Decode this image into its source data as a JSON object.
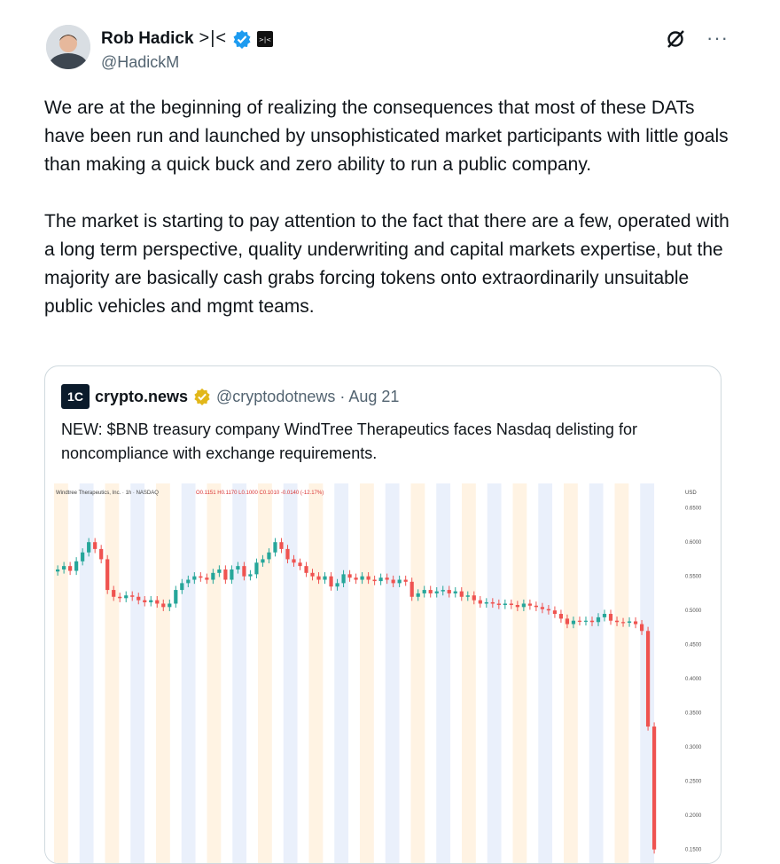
{
  "author": {
    "name": "Rob Hadick",
    "name_suffix": ">|<",
    "handle": "@HadickM",
    "verified_icon": "verified-badge-icon",
    "affiliation_icon": "affiliate-badge-icon"
  },
  "actions": {
    "grok_icon": "grok-icon",
    "more_icon": "more-icon",
    "more_glyph": "···"
  },
  "tweet": {
    "paragraph1": "We are at the beginning of realizing the consequences that most of these DATs have been run and launched by unsophisticated market participants with little goals than making a quick buck and zero ability to run a public company.",
    "paragraph2": "The market is starting to pay attention to the fact that there are a few, operated with a long term perspective, quality underwriting and capital markets expertise, but the majority are basically cash grabs forcing tokens onto extraordinarily unsuitable public vehicles and mgmt teams."
  },
  "quote": {
    "logo_text": "1C",
    "name": "crypto.news",
    "handle_date": "@cryptodotnews · Aug 21",
    "text": "NEW: $BNB treasury company WindTree Therapeutics faces Nasdaq delisting for noncompliance with exchange requirements."
  },
  "chart_data": {
    "type": "candlestick",
    "title": "Windtree Therapeutics, Inc. · 1h · NASDAQ",
    "ohlc_text": "O0.1151 H0.1170 L0.1000 C0.1010 -0.0140 (-12.17%)",
    "currency_label": "USD",
    "y_ticks": [
      "0.6500",
      "0.6000",
      "0.5500",
      "0.5000",
      "0.4500",
      "0.4000",
      "0.3500",
      "0.3000",
      "0.2500",
      "0.2000",
      "0.1500"
    ],
    "ylim": [
      0.13,
      0.66
    ],
    "up_color": "#26a69a",
    "down_color": "#ef5350",
    "closes": [
      0.56,
      0.565,
      0.558,
      0.572,
      0.585,
      0.6,
      0.59,
      0.575,
      0.53,
      0.52,
      0.518,
      0.522,
      0.52,
      0.515,
      0.512,
      0.515,
      0.51,
      0.505,
      0.51,
      0.53,
      0.54,
      0.545,
      0.55,
      0.548,
      0.545,
      0.555,
      0.56,
      0.545,
      0.56,
      0.565,
      0.55,
      0.553,
      0.57,
      0.575,
      0.585,
      0.6,
      0.59,
      0.575,
      0.57,
      0.565,
      0.555,
      0.55,
      0.545,
      0.55,
      0.535,
      0.54,
      0.553,
      0.548,
      0.545,
      0.55,
      0.545,
      0.543,
      0.548,
      0.545,
      0.54,
      0.545,
      0.542,
      0.52,
      0.525,
      0.53,
      0.525,
      0.528,
      0.53,
      0.525,
      0.528,
      0.52,
      0.522,
      0.515,
      0.51,
      0.512,
      0.51,
      0.508,
      0.51,
      0.508,
      0.505,
      0.51,
      0.507,
      0.505,
      0.502,
      0.5,
      0.495,
      0.488,
      0.48,
      0.485,
      0.484,
      0.485,
      0.483,
      0.49,
      0.495,
      0.485,
      0.483,
      0.482,
      0.484,
      0.48,
      0.47,
      0.33,
      0.15
    ],
    "shaded_bands": 24
  }
}
